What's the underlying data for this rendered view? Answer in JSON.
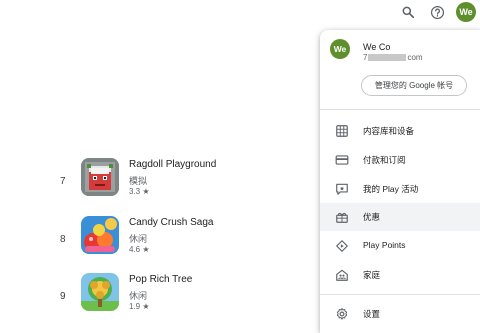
{
  "topbar": {
    "search_icon": "search-icon",
    "help_icon": "help-icon",
    "avatar_initials": "We",
    "avatar_color": "#5f8f2d"
  },
  "app_list": [
    {
      "rank": "7",
      "title": "Ragdoll Playground",
      "category": "模拟",
      "rating": "3.3 ★"
    },
    {
      "rank": "8",
      "title": "Candy Crush Saga",
      "category": "休闲",
      "rating": "4.6 ★"
    },
    {
      "rank": "9",
      "title": "Pop Rich Tree",
      "category": "休闲",
      "rating": "1.9 ★"
    }
  ],
  "account_menu": {
    "avatar_initials": "We",
    "name": "We Co",
    "email_prefix": "7",
    "email_suffix": "com",
    "manage_button": "管理您的 Google 帐号",
    "items": [
      {
        "label": "内容库和设备",
        "icon": "library-icon"
      },
      {
        "label": "付款和订阅",
        "icon": "payment-card-icon"
      },
      {
        "label": "我的 Play 活动",
        "icon": "play-activity-icon"
      },
      {
        "label": "优惠",
        "icon": "offers-icon",
        "highlighted": true
      },
      {
        "label": "Play Points",
        "icon": "play-points-icon"
      },
      {
        "label": "家庭",
        "icon": "family-icon"
      },
      {
        "label": "设置",
        "icon": "settings-icon"
      }
    ]
  }
}
